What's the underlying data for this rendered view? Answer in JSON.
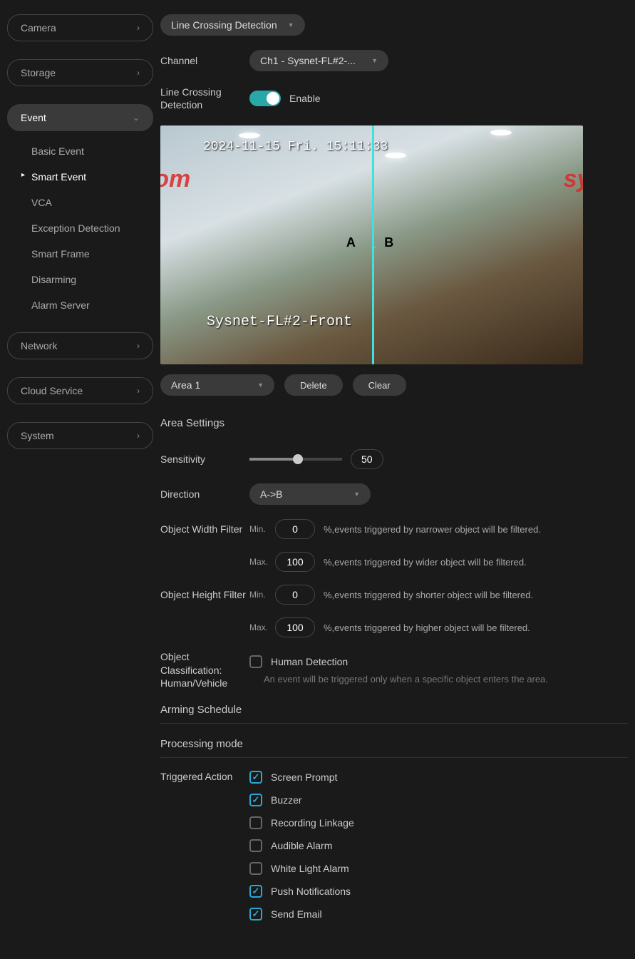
{
  "sidebar": {
    "camera": "Camera",
    "storage": "Storage",
    "event": "Event",
    "network": "Network",
    "cloud": "Cloud Service",
    "system": "System",
    "sub": {
      "basic": "Basic Event",
      "smart": "Smart Event",
      "vca": "VCA",
      "exception": "Exception Detection",
      "frame": "Smart Frame",
      "disarming": "Disarming",
      "alarm": "Alarm Server"
    }
  },
  "top_select": "Line Crossing Detection",
  "channel": {
    "label": "Channel",
    "value": "Ch1 - Sysnet-FL#2-..."
  },
  "lcd": {
    "label": "Line Crossing Detection",
    "enable": "Enable"
  },
  "preview": {
    "timestamp": "2024-11-15 Fri. 15:11:33",
    "name": "Sysnet-FL#2-Front",
    "a": "A",
    "b": "B",
    "watermark": "sysnetcenter.com"
  },
  "area_select": "Area 1",
  "buttons": {
    "delete": "Delete",
    "clear": "Clear"
  },
  "area_settings": {
    "title": "Area Settings",
    "sensitivity": {
      "label": "Sensitivity",
      "value": "50"
    },
    "direction": {
      "label": "Direction",
      "value": "A->B"
    },
    "width": {
      "label": "Object Width Filter",
      "min_label": "Min.",
      "min": "0",
      "min_hint": "%,events triggered by narrower object will be filtered.",
      "max_label": "Max.",
      "max": "100",
      "max_hint": "%,events triggered by wider object will be filtered."
    },
    "height": {
      "label": "Object Height Filter",
      "min_label": "Min.",
      "min": "0",
      "min_hint": "%,events triggered by shorter object will be filtered.",
      "max_label": "Max.",
      "max": "100",
      "max_hint": "%,events triggered by higher object will be filtered."
    },
    "classification": {
      "label": "Object Classification: Human/Vehicle",
      "option": "Human Detection",
      "hint": "An event will be triggered only when a specific object enters the area."
    }
  },
  "arming": {
    "title": "Arming Schedule"
  },
  "processing": {
    "title": "Processing mode",
    "triggered": "Triggered Action",
    "actions": {
      "screen": "Screen Prompt",
      "buzzer": "Buzzer",
      "recording": "Recording Linkage",
      "audible": "Audible Alarm",
      "white": "White Light Alarm",
      "push": "Push Notifications",
      "email": "Send Email"
    }
  }
}
